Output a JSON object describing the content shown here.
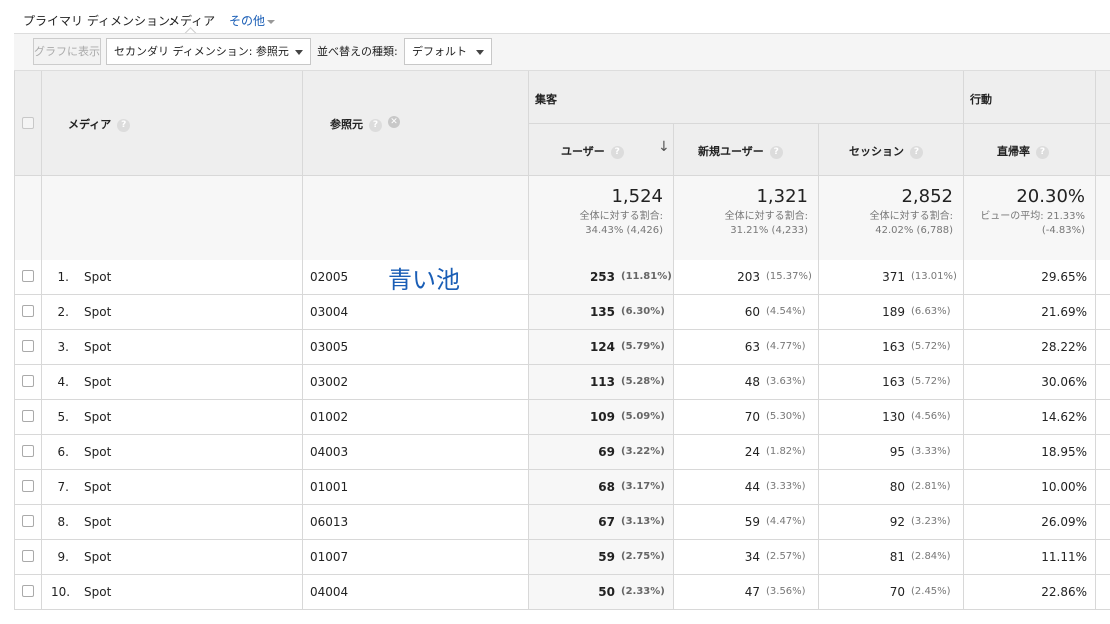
{
  "primary_bar": {
    "label": "プライマリ ディメンション:",
    "value": "メディア",
    "other": "その他"
  },
  "toolbar": {
    "graph_button": "グラフに表示",
    "secondary_dimension": "セカンダリ ディメンション: 参照元",
    "sort_label": "並べ替えの種類:",
    "sort_value": "デフォルト"
  },
  "table": {
    "headers": {
      "medium": "メディア",
      "source": "参照元",
      "acquisition": "集客",
      "behavior": "行動",
      "users": "ユーザー",
      "new_users": "新規ユーザー",
      "sessions": "セッション",
      "bounce_rate": "直帰率"
    },
    "summary": {
      "users": {
        "value": "1,524",
        "line1": "全体に対する割合:",
        "line2": "34.43% (4,426)"
      },
      "new_users": {
        "value": "1,321",
        "line1": "全体に対する割合:",
        "line2": "31.21% (4,233)"
      },
      "sessions": {
        "value": "2,852",
        "line1": "全体に対する割合:",
        "line2": "42.02% (6,788)"
      },
      "bounce_rate": {
        "value": "20.30%",
        "line1": "ビューの平均: 21.33%",
        "line2": "(-4.83%)"
      }
    },
    "rows": [
      {
        "num": "1.",
        "medium": "Spot",
        "source": "02005",
        "users": "253",
        "users_pct": "(11.81%)",
        "new_users": "203",
        "new_users_pct": "(15.37%)",
        "sessions": "371",
        "sessions_pct": "(13.01%)",
        "bounce": "29.65%"
      },
      {
        "num": "2.",
        "medium": "Spot",
        "source": "03004",
        "users": "135",
        "users_pct": "(6.30%)",
        "new_users": "60",
        "new_users_pct": "(4.54%)",
        "sessions": "189",
        "sessions_pct": "(6.63%)",
        "bounce": "21.69%"
      },
      {
        "num": "3.",
        "medium": "Spot",
        "source": "03005",
        "users": "124",
        "users_pct": "(5.79%)",
        "new_users": "63",
        "new_users_pct": "(4.77%)",
        "sessions": "163",
        "sessions_pct": "(5.72%)",
        "bounce": "28.22%"
      },
      {
        "num": "4.",
        "medium": "Spot",
        "source": "03002",
        "users": "113",
        "users_pct": "(5.28%)",
        "new_users": "48",
        "new_users_pct": "(3.63%)",
        "sessions": "163",
        "sessions_pct": "(5.72%)",
        "bounce": "30.06%"
      },
      {
        "num": "5.",
        "medium": "Spot",
        "source": "01002",
        "users": "109",
        "users_pct": "(5.09%)",
        "new_users": "70",
        "new_users_pct": "(5.30%)",
        "sessions": "130",
        "sessions_pct": "(4.56%)",
        "bounce": "14.62%"
      },
      {
        "num": "6.",
        "medium": "Spot",
        "source": "04003",
        "users": "69",
        "users_pct": "(3.22%)",
        "new_users": "24",
        "new_users_pct": "(1.82%)",
        "sessions": "95",
        "sessions_pct": "(3.33%)",
        "bounce": "18.95%"
      },
      {
        "num": "7.",
        "medium": "Spot",
        "source": "01001",
        "users": "68",
        "users_pct": "(3.17%)",
        "new_users": "44",
        "new_users_pct": "(3.33%)",
        "sessions": "80",
        "sessions_pct": "(2.81%)",
        "bounce": "10.00%"
      },
      {
        "num": "8.",
        "medium": "Spot",
        "source": "06013",
        "users": "67",
        "users_pct": "(3.13%)",
        "new_users": "59",
        "new_users_pct": "(4.47%)",
        "sessions": "92",
        "sessions_pct": "(3.23%)",
        "bounce": "26.09%"
      },
      {
        "num": "9.",
        "medium": "Spot",
        "source": "01007",
        "users": "59",
        "users_pct": "(2.75%)",
        "new_users": "34",
        "new_users_pct": "(2.57%)",
        "sessions": "81",
        "sessions_pct": "(2.84%)",
        "bounce": "11.11%"
      },
      {
        "num": "10.",
        "medium": "Spot",
        "source": "04004",
        "users": "50",
        "users_pct": "(2.33%)",
        "new_users": "47",
        "new_users_pct": "(3.56%)",
        "sessions": "70",
        "sessions_pct": "(2.45%)",
        "bounce": "22.86%"
      }
    ]
  },
  "annotation": "青い池",
  "colors": {
    "link": "#1a5eb6",
    "header_bg": "#eeeeee",
    "annotation": "#1a5eb6"
  }
}
